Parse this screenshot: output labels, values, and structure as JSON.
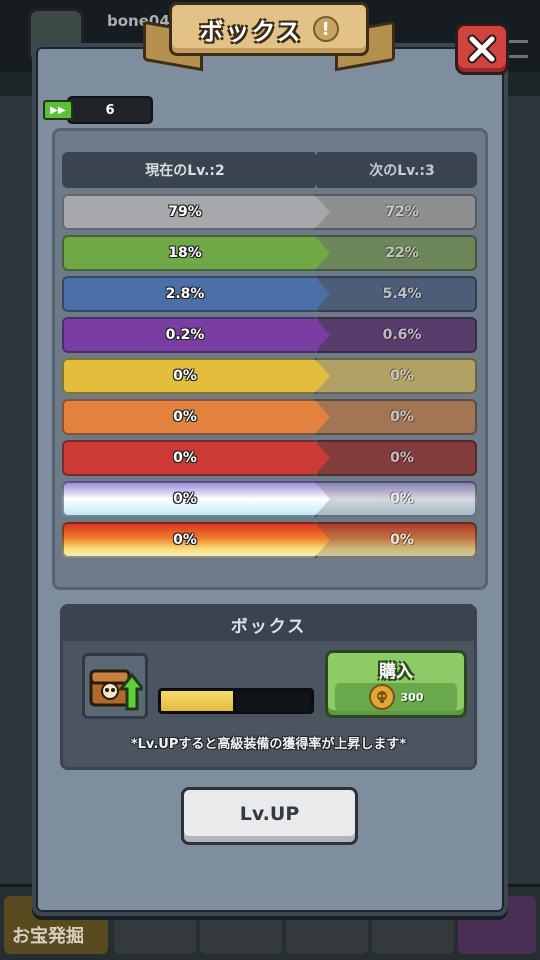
{
  "background": {
    "player_name": "bone04",
    "bottom_tab_label": "お宝発掘"
  },
  "dialog": {
    "title": "ボックス",
    "info_icon": "!",
    "close_icon": "close-x-icon"
  },
  "ticket": {
    "icon": "ticket-icon",
    "count": "6"
  },
  "table": {
    "current_header": "現在のLv.:2",
    "next_header": "次のLv.:3",
    "rows": [
      {
        "current": "79%",
        "next": "72%",
        "color": "#a6a8ab"
      },
      {
        "current": "18%",
        "next": "22%",
        "color": "#6fa847"
      },
      {
        "current": "2.8%",
        "next": "5.4%",
        "color": "#4b6fa6"
      },
      {
        "current": "0.2%",
        "next": "0.6%",
        "color": "#7a3ea2"
      },
      {
        "current": "0%",
        "next": "0%",
        "color": "#e3be3c"
      },
      {
        "current": "0%",
        "next": "0%",
        "color": "#e3823f"
      },
      {
        "current": "0%",
        "next": "0%",
        "color": "#cc3a35"
      },
      {
        "current": "0%",
        "next": "0%",
        "color": "#c7b9f2"
      },
      {
        "current": "0%",
        "next": "0%",
        "color": "#e85a24"
      }
    ]
  },
  "box": {
    "header": "ボックス",
    "progress": 0.5,
    "buy_label": "購入",
    "price": "300",
    "note": "*Lv.UPすると高級装備の獲得率が上昇します*",
    "lvup_label": "Lv.UP"
  }
}
